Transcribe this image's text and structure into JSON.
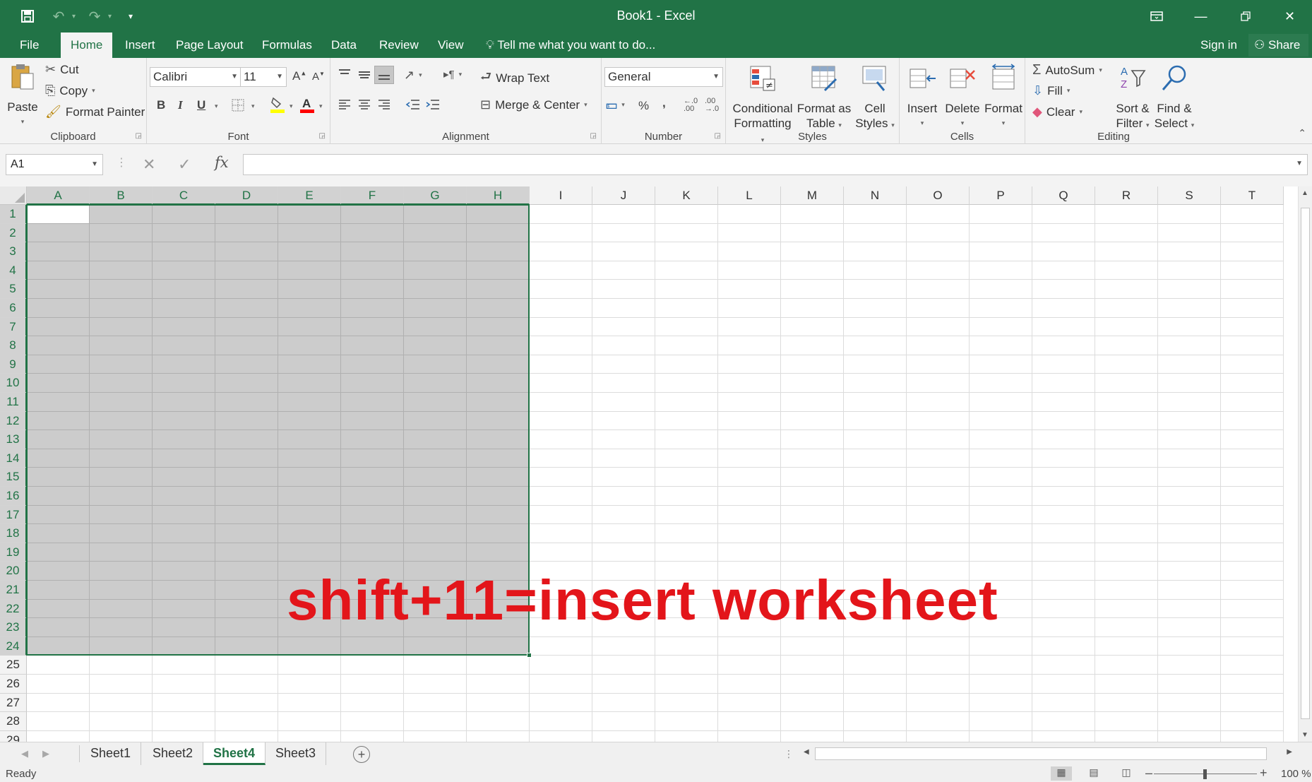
{
  "app": {
    "title": "Book1 - Excel",
    "sign_in": "Sign in",
    "share": "Share"
  },
  "qat": {
    "save_icon": "save-icon",
    "undo_icon": "undo-icon",
    "redo_icon": "redo-icon",
    "customize_icon": "customize-qat-icon"
  },
  "tabs": [
    "File",
    "Home",
    "Insert",
    "Page Layout",
    "Formulas",
    "Data",
    "Review",
    "View"
  ],
  "active_tab": "Home",
  "tell_me": "Tell me what you want to do...",
  "ribbon": {
    "clipboard": {
      "label": "Clipboard",
      "paste": "Paste",
      "cut": "Cut",
      "copy": "Copy",
      "format_painter": "Format Painter"
    },
    "font": {
      "label": "Font",
      "font_name": "Calibri",
      "font_size": "11",
      "bold": "B",
      "italic": "I",
      "underline": "U",
      "grow": "A",
      "shrink": "A",
      "fill_color": "#ffff00",
      "font_color": "#ff0000"
    },
    "alignment": {
      "label": "Alignment",
      "wrap_text": "Wrap Text",
      "merge_center": "Merge & Center"
    },
    "number": {
      "label": "Number",
      "format": "General",
      "percent": "%",
      "comma": ","
    },
    "styles": {
      "label": "Styles",
      "conditional_1": "Conditional",
      "conditional_2": "Formatting",
      "format_table_1": "Format as",
      "format_table_2": "Table",
      "cell_styles_1": "Cell",
      "cell_styles_2": "Styles"
    },
    "cells": {
      "label": "Cells",
      "insert": "Insert",
      "delete": "Delete",
      "format": "Format"
    },
    "editing": {
      "label": "Editing",
      "autosum": "AutoSum",
      "fill": "Fill",
      "clear": "Clear",
      "sort_1": "Sort &",
      "sort_2": "Filter",
      "find_1": "Find &",
      "find_2": "Select"
    }
  },
  "formula_bar": {
    "name_box": "A1",
    "fx": "fx",
    "value": ""
  },
  "grid": {
    "columns": [
      "A",
      "B",
      "C",
      "D",
      "E",
      "F",
      "G",
      "H",
      "I",
      "J",
      "K",
      "L",
      "M",
      "N",
      "O",
      "P",
      "Q",
      "R",
      "S",
      "T"
    ],
    "rows": [
      "1",
      "2",
      "3",
      "4",
      "5",
      "6",
      "7",
      "8",
      "9",
      "10",
      "11",
      "12",
      "13",
      "14",
      "15",
      "16",
      "17",
      "18",
      "19",
      "20",
      "21",
      "22",
      "23",
      "24",
      "25",
      "26",
      "27",
      "28",
      "29"
    ],
    "selection": "A1:H24",
    "active_cell": "A1"
  },
  "overlay_text": "shift+11=insert worksheet",
  "sheets": [
    "Sheet1",
    "Sheet2",
    "Sheet4",
    "Sheet3"
  ],
  "active_sheet": "Sheet4",
  "status": {
    "ready": "Ready",
    "zoom": "100 %"
  },
  "colors": {
    "excel_green": "#217346",
    "overlay_red": "#e3151a",
    "selection_shade": "#c8c8c8"
  }
}
